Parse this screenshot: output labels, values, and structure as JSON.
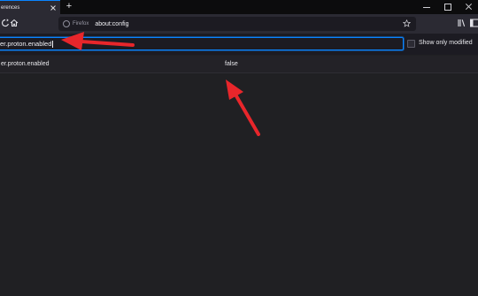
{
  "tab": {
    "label": "erences"
  },
  "urlbar": {
    "identity_label": "Firefox",
    "url": "about:config"
  },
  "search": {
    "value": "er.proton.enabled",
    "show_modified_label": "Show only modified"
  },
  "prefs": [
    {
      "name": "er.proton.enabled",
      "value": "false"
    }
  ],
  "colors": {
    "accent": "#0a84ff",
    "annotation_arrow": "#e8262b",
    "background": "#202023",
    "toolbar": "#2b2a33"
  },
  "icons": [
    "close-icon",
    "new-tab-icon",
    "reload-icon",
    "home-icon",
    "firefox-icon",
    "bookmark-star-icon",
    "library-icon",
    "sidebar-icon",
    "menu-icon",
    "annotation-arrow"
  ]
}
